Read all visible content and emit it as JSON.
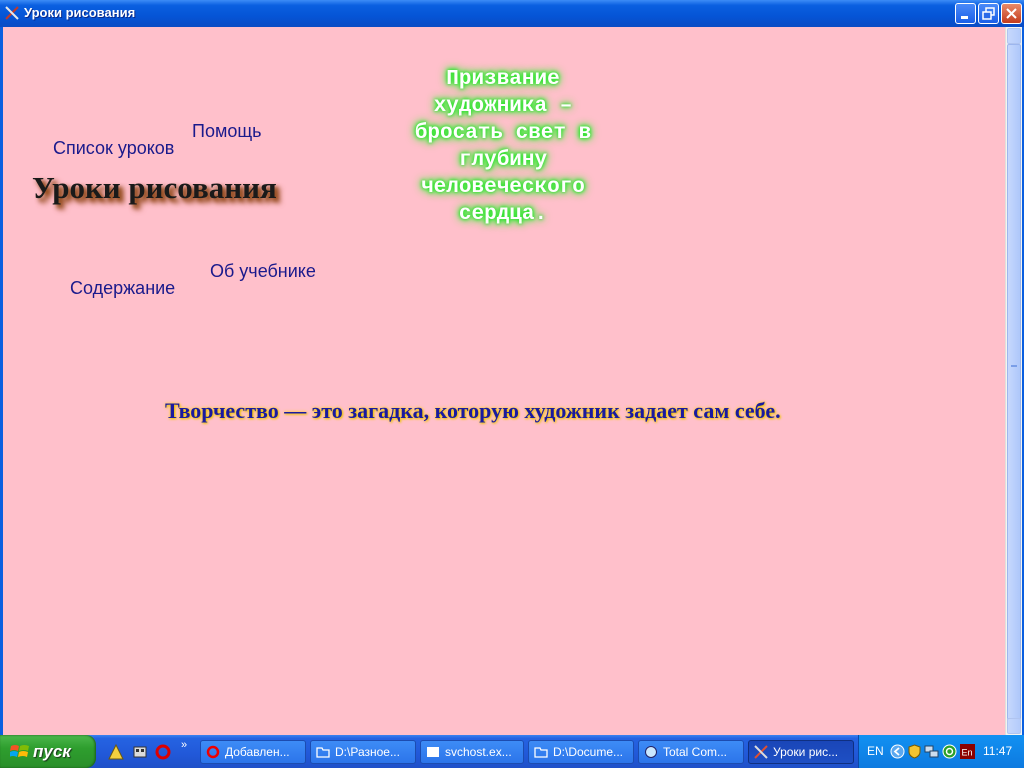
{
  "window": {
    "title": "Уроки рисования"
  },
  "nav": {
    "lesson_list": "Список уроков",
    "help": "Помощь",
    "contents": "Содержание",
    "about": "Об учебнике"
  },
  "heading": "Уроки рисования",
  "quote": "Призвание художника – бросать свет в глубину человеческого сердца.",
  "saying": "Творчество — это загадка, которую художник задает сам себе.",
  "taskbar": {
    "start_label": "пуск",
    "chevron": "»",
    "tasks": [
      {
        "label": "Добавлен..."
      },
      {
        "label": "D:\\Разное..."
      },
      {
        "label": "svchost.ex..."
      },
      {
        "label": "D:\\Docume..."
      },
      {
        "label": "Total Com..."
      },
      {
        "label": "Уроки рис..."
      }
    ],
    "language": "EN",
    "clock": "11:47"
  },
  "colors": {
    "background": "#ffc0cb",
    "link": "#1a1a8c",
    "quote_glow": "#33ff33",
    "saying": "#1a1aa0"
  }
}
